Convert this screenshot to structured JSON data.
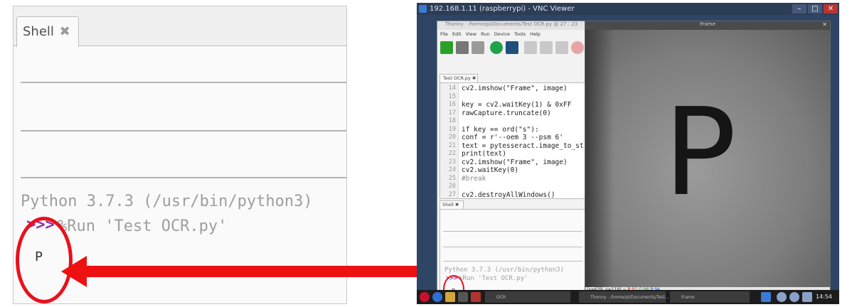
{
  "zoom": {
    "tab_label": "Shell",
    "tab_close": "✖",
    "python_version": "Python 3.7.3 (/usr/bin/python3)",
    "prompt": ">>>",
    "command": "%Run 'Test OCR.py'",
    "output": "P"
  },
  "vnc": {
    "window_title": "192.168.1.11 (raspberrypi) - VNC Viewer",
    "win_buttons": [
      "–",
      "□",
      "✕"
    ]
  },
  "thonny": {
    "title": "Thonny - /home/pi/Documents/Test OCR.py @ 27 : 23",
    "menu": [
      "File",
      "Edit",
      "View",
      "Run",
      "Device",
      "Tools",
      "Help"
    ],
    "editor_tab": "Test OCR.py ✖",
    "lines": [
      {
        "n": "14",
        "code": "    cv2.imshow(\"Frame\", image)"
      },
      {
        "n": "15",
        "code": ""
      },
      {
        "n": "16",
        "code": "    key = cv2.waitKey(1) & 0xFF"
      },
      {
        "n": "17",
        "code": "    rawCapture.truncate(0)"
      },
      {
        "n": "18",
        "code": ""
      },
      {
        "n": "19",
        "code": "    if key == ord(\"s\"):"
      },
      {
        "n": "20",
        "code": "        conf = r'--oem 3 --psm 6'"
      },
      {
        "n": "21",
        "code": "        text = pytesseract.image_to_string"
      },
      {
        "n": "22",
        "code": "        print(text)"
      },
      {
        "n": "23",
        "code": "        cv2.imshow(\"Frame\", image)"
      },
      {
        "n": "24",
        "code": "        cv2.waitKey(0)"
      },
      {
        "n": "25",
        "code": "        #break"
      },
      {
        "n": "26",
        "code": ""
      },
      {
        "n": "27",
        "code": "cv2.destroyAllWindows()"
      }
    ],
    "shell_tab": "Shell ✖",
    "shell_version": "Python 3.7.3 (/usr/bin/python3)",
    "shell_prompt": ">>>",
    "shell_command": "%Run 'Test OCR.py'",
    "shell_output": "P"
  },
  "frame": {
    "title": "Frame",
    "close": "✕",
    "letter": "P",
    "status_prefix": "(x=639, y=119) ~ ",
    "r": "R:91",
    "g": "G:98",
    "b": "B:94"
  },
  "taskbar": {
    "tasks": [
      "OCR",
      "Thonny - /home/pi/Documents/Test...",
      "Frame"
    ],
    "clock": "14:54"
  },
  "colors": {
    "annotation_red": "#e8111c",
    "prompt_purple": "#8a2fa8"
  }
}
